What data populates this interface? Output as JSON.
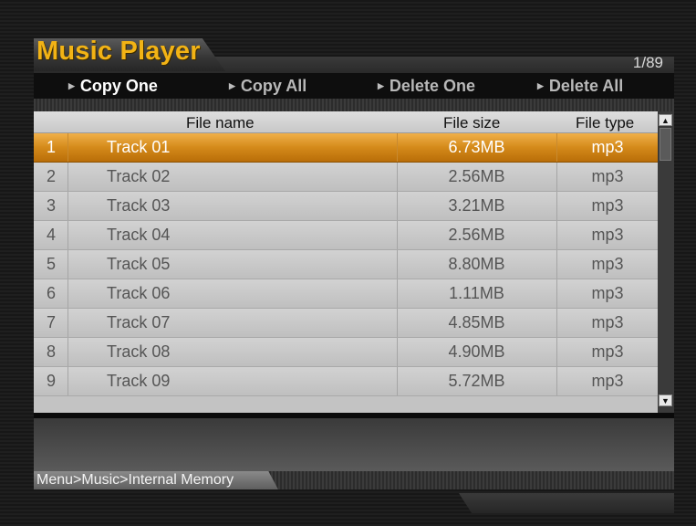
{
  "app": {
    "title": "Music Player",
    "page_counter": "1/89"
  },
  "actions": [
    {
      "label": "Copy One",
      "active": true
    },
    {
      "label": "Copy All",
      "active": false
    },
    {
      "label": "Delete One",
      "active": false
    },
    {
      "label": "Delete All",
      "active": false
    }
  ],
  "table": {
    "headers": {
      "name": "File name",
      "size": "File size",
      "type": "File type"
    },
    "rows": [
      {
        "num": "1",
        "name": "Track 01",
        "size": "6.73MB",
        "type": "mp3",
        "selected": true
      },
      {
        "num": "2",
        "name": "Track 02",
        "size": "2.56MB",
        "type": "mp3"
      },
      {
        "num": "3",
        "name": "Track 03",
        "size": "3.21MB",
        "type": "mp3"
      },
      {
        "num": "4",
        "name": "Track 04",
        "size": "2.56MB",
        "type": "mp3"
      },
      {
        "num": "5",
        "name": "Track 05",
        "size": "8.80MB",
        "type": "mp3"
      },
      {
        "num": "6",
        "name": "Track 06",
        "size": "1.11MB",
        "type": "mp3"
      },
      {
        "num": "7",
        "name": "Track 07",
        "size": "4.85MB",
        "type": "mp3"
      },
      {
        "num": "8",
        "name": "Track 08",
        "size": "4.90MB",
        "type": "mp3"
      },
      {
        "num": "9",
        "name": "Track 09",
        "size": "5.72MB",
        "type": "mp3"
      }
    ]
  },
  "breadcrumb": "Menu>Music>Internal Memory",
  "icons": {
    "scroll_up": "chevron-up-icon",
    "scroll_down": "chevron-down-icon",
    "action_arrow": "triangle-right-icon"
  },
  "colors": {
    "accent": "#f2b315",
    "selected_row": "#d48a1a"
  }
}
